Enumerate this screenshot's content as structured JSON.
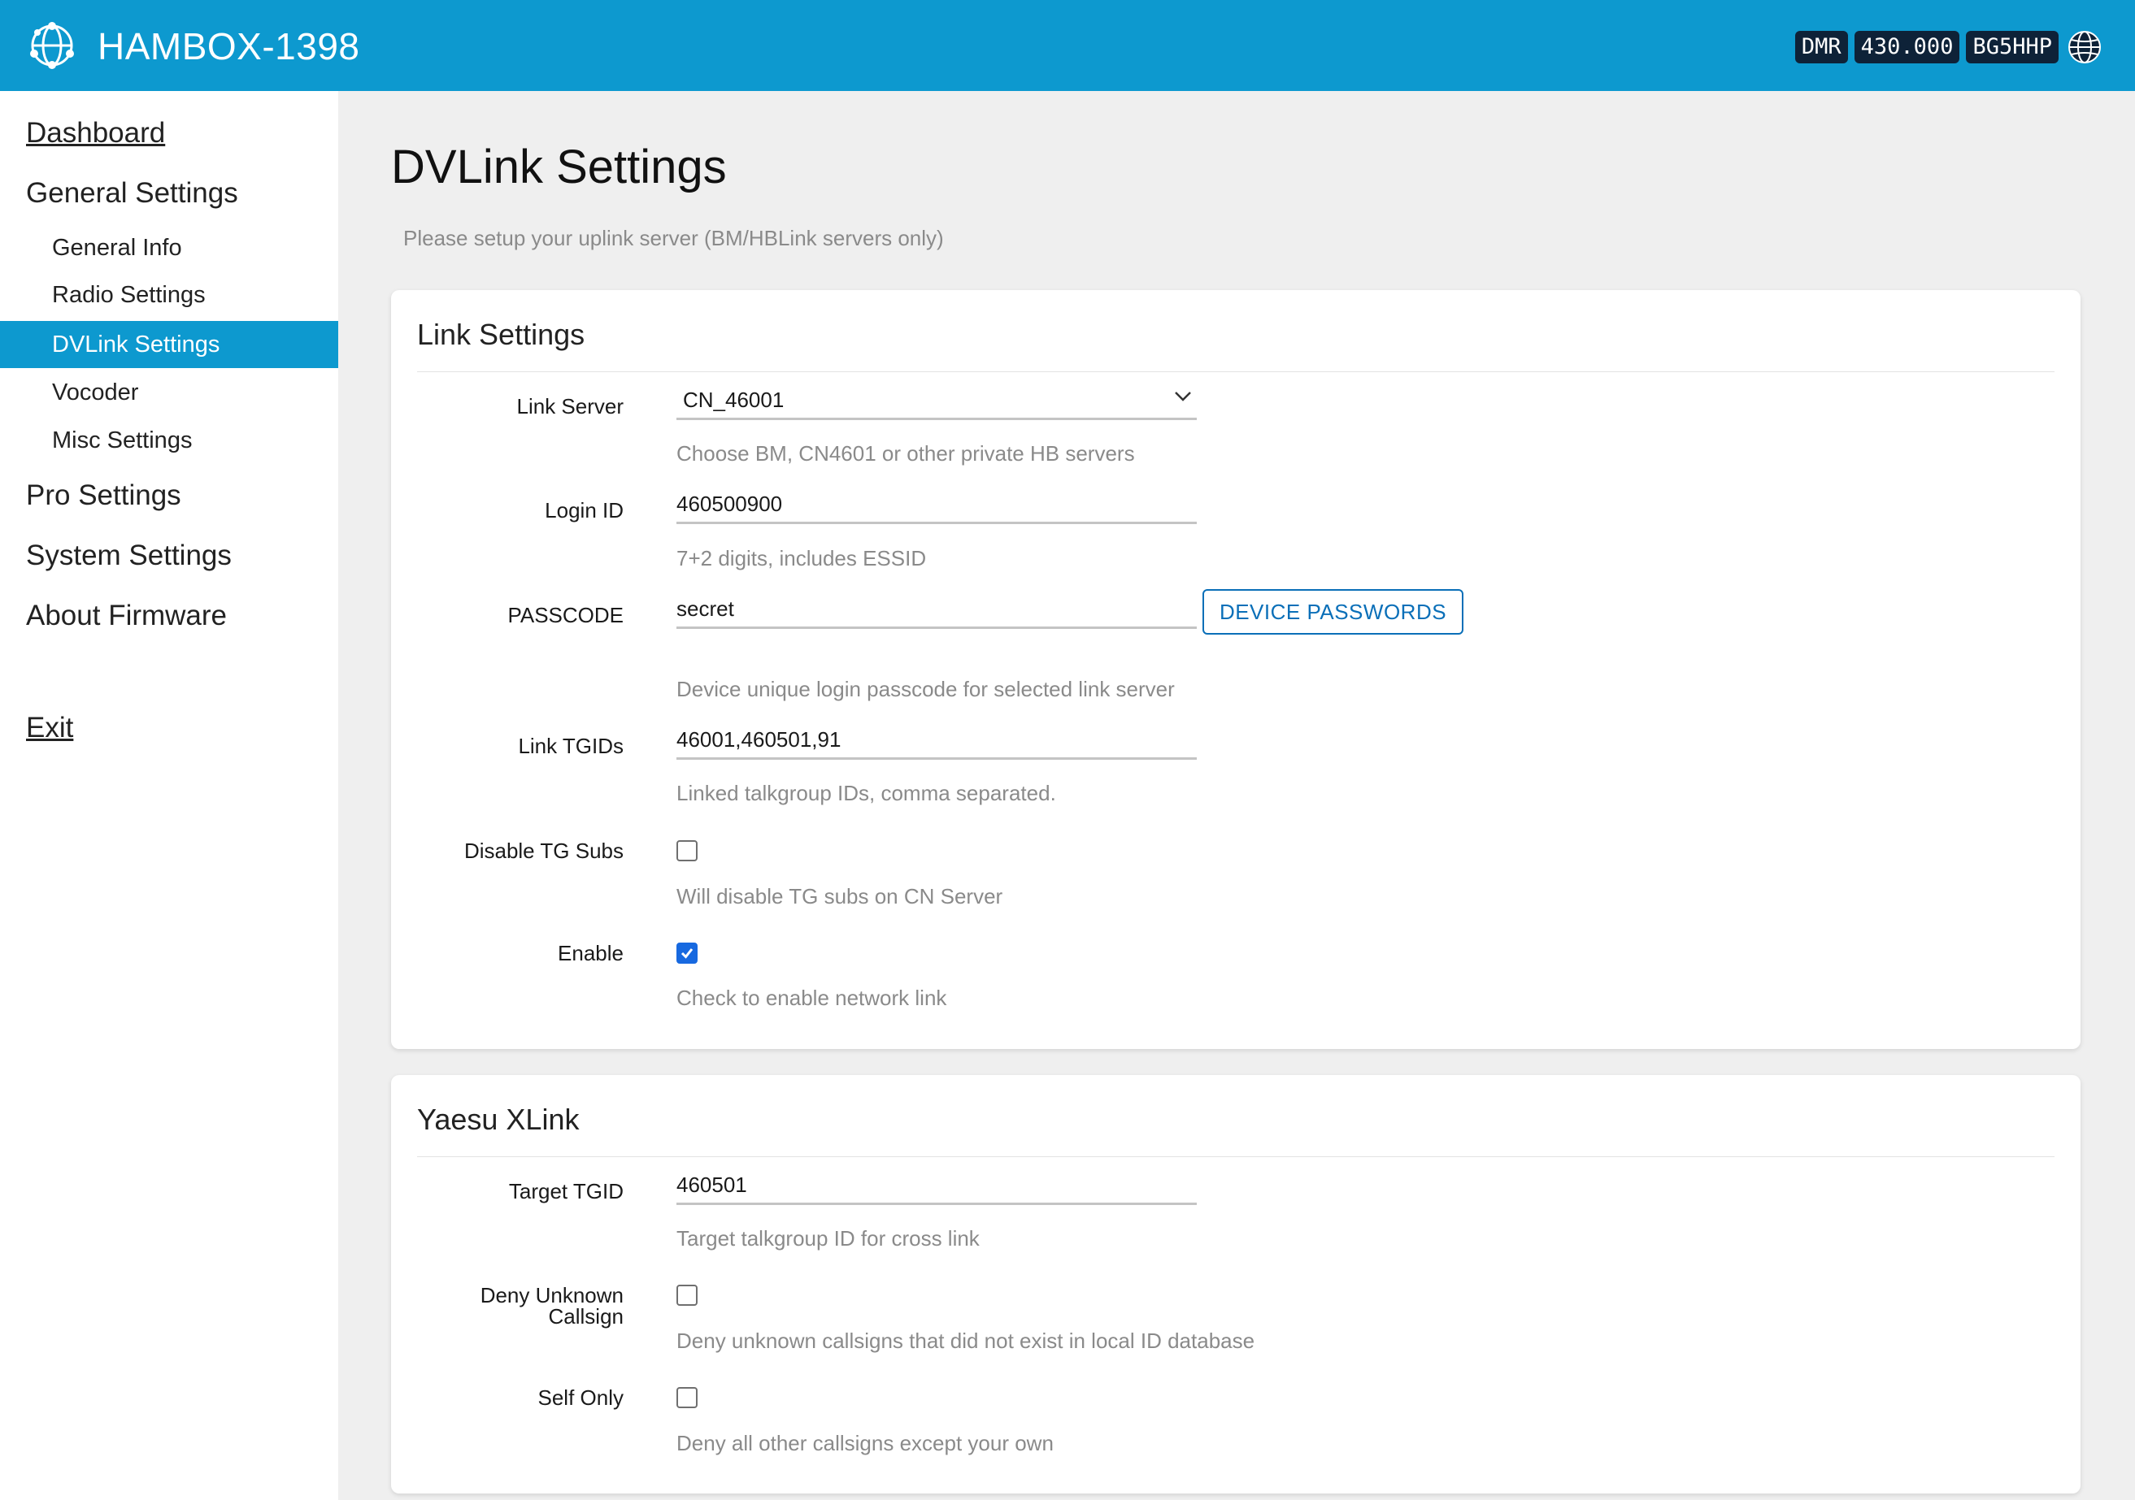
{
  "header": {
    "title": "HAMBOX-1398",
    "badges": [
      "DMR",
      "430.000",
      "BG5HHP"
    ],
    "logo_icon": "network-globe-icon",
    "status_icon": "globe-icon"
  },
  "sidebar": {
    "dashboard": "Dashboard",
    "general": "General Settings",
    "general_items": [
      "General Info",
      "Radio Settings",
      "DVLink Settings",
      "Vocoder",
      "Misc Settings"
    ],
    "active_item": "DVLink Settings",
    "pro": "Pro Settings",
    "system": "System Settings",
    "about": "About Firmware",
    "exit": "Exit"
  },
  "page": {
    "title": "DVLink Settings",
    "description": "Please setup your uplink server (BM/HBLink servers only)"
  },
  "link_settings": {
    "title": "Link Settings",
    "link_server": {
      "label": "Link Server",
      "value": "CN_46001",
      "hint": "Choose BM, CN4601 or other private HB servers"
    },
    "login_id": {
      "label": "Login ID",
      "value": "460500900",
      "hint": "7+2 digits, includes ESSID"
    },
    "passcode": {
      "label": "PASSCODE",
      "value": "secret",
      "button": "DEVICE PASSWORDS",
      "hint": "Device unique login passcode for selected link server"
    },
    "link_tgids": {
      "label": "Link TGIDs",
      "value": "46001,460501,91",
      "hint": "Linked talkgroup IDs, comma separated."
    },
    "disable_tg_subs": {
      "label": "Disable TG Subs",
      "checked": false,
      "hint": "Will disable TG subs on CN Server"
    },
    "enable": {
      "label": "Enable",
      "checked": true,
      "hint": "Check to enable network link"
    }
  },
  "yaesu_xlink": {
    "title": "Yaesu XLink",
    "target_tgid": {
      "label": "Target TGID",
      "value": "460501",
      "hint": "Target talkgroup ID for cross link"
    },
    "deny_unknown": {
      "label_line1": "Deny Unknown",
      "label_line2": "Callsign",
      "checked": false,
      "hint": "Deny unknown callsigns that did not exist in local ID database"
    },
    "self_only": {
      "label": "Self Only",
      "checked": false,
      "hint": "Deny all other callsigns except your own"
    }
  },
  "colors": {
    "accent": "#0d99cf",
    "checkbox_on": "#1769e0",
    "button": "#0a6fb8",
    "badge_bg": "#0e2238"
  }
}
